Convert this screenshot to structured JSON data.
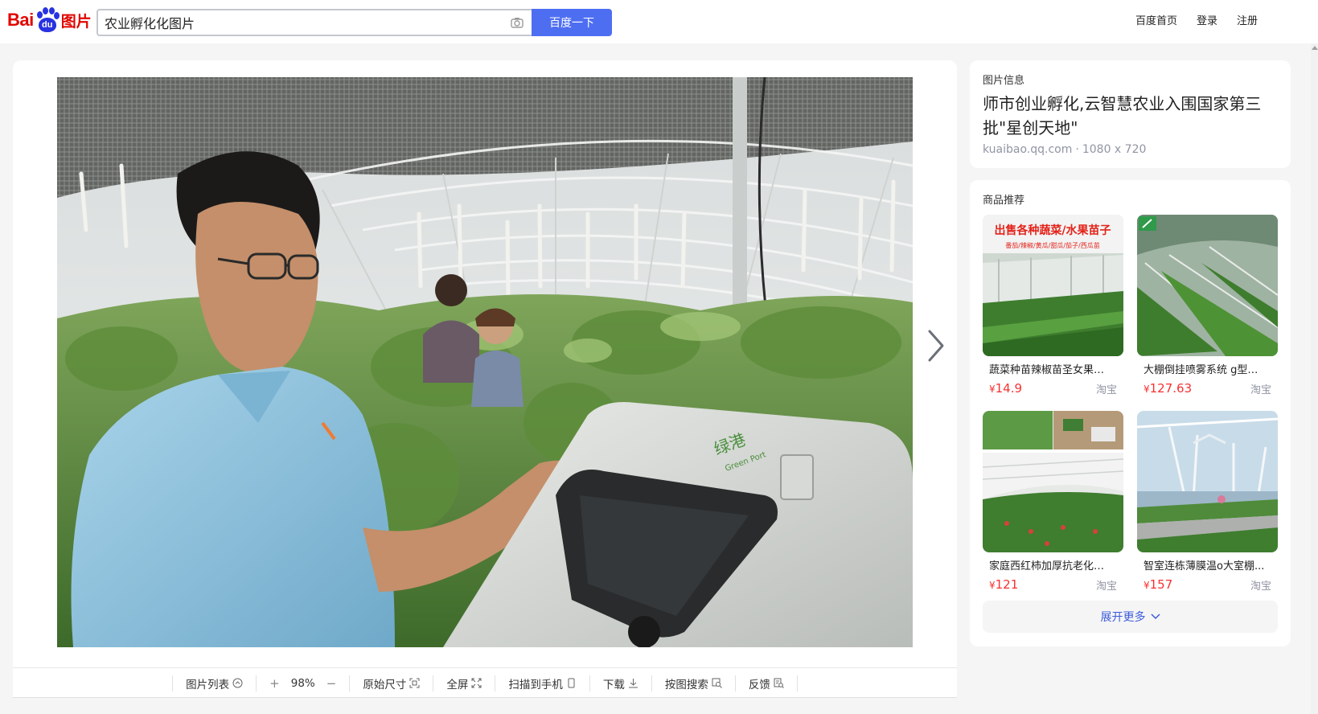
{
  "header": {
    "logo_bai": "Bai",
    "logo_du": "du",
    "logo_pic": "图片",
    "search_value": "农业孵化化图片",
    "search_button": "百度一下",
    "links": [
      "百度首页",
      "登录",
      "注册"
    ]
  },
  "toolbar": {
    "list": "图片列表",
    "zoom_in": "+",
    "zoom": "98%",
    "zoom_out": "−",
    "original": "原始尺寸",
    "fullscreen": "全屏",
    "scan": "扫描到手机",
    "download": "下载",
    "search_by_image": "按图搜索",
    "feedback": "反馈"
  },
  "info": {
    "label": "图片信息",
    "title": "师市创业孵化,云智慧农业入围国家第三批\"星创天地\"",
    "source": "kuaibao.qq.com",
    "dimensions": "1080 x 720"
  },
  "recommend": {
    "label": "商品推荐",
    "items": [
      {
        "name": "蔬菜种苗辣椒苗圣女果西...",
        "currency": "¥",
        "price": "14.9",
        "shop": "淘宝",
        "banner": "出售各种蔬菜/水果苗子",
        "banner_sub": "番茄/辣椒/黄瓜/甜瓜/茄子/西瓜苗"
      },
      {
        "name": "大棚倒挂喷雾系统 g型雾...",
        "currency": "¥",
        "price": "127.63",
        "shop": "淘宝"
      },
      {
        "name": "家庭西红柿加厚抗老化葡...",
        "currency": "¥",
        "price": "121",
        "shop": "淘宝"
      },
      {
        "name": "智室连栋薄膜温o大室棚...",
        "currency": "¥",
        "price": "157",
        "shop": "淘宝"
      }
    ],
    "more": "展开更多"
  },
  "photo": {
    "panel_brand": "绿港",
    "panel_brand_en": "Green Port"
  },
  "colors": {
    "accent": "#4e6ef2",
    "price": "#f73131",
    "logo_red": "#e10601",
    "logo_blue": "#2932e1"
  }
}
